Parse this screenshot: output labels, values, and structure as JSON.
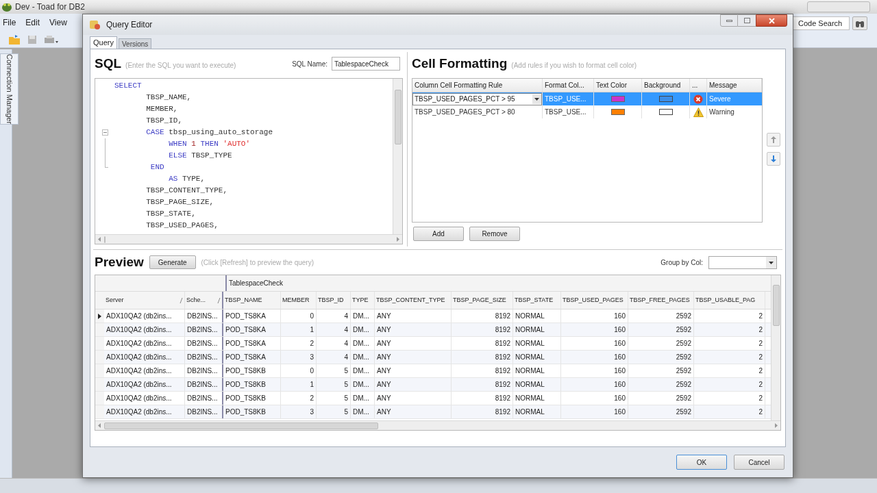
{
  "app": {
    "title": "Dev - Toad for DB2",
    "menu": [
      "File",
      "Edit",
      "View"
    ],
    "side_tab": "Connection Manager",
    "code_search": "Code Search"
  },
  "dialog": {
    "title": "Query Editor",
    "tabs": [
      {
        "label": "Query",
        "selected": true
      },
      {
        "label": "Versions",
        "selected": false
      }
    ],
    "sql": {
      "heading": "SQL",
      "hint": "(Enter the SQL you want to execute)",
      "name_label": "SQL Name:",
      "name_value": "TablespaceCheck",
      "lines": [
        {
          "tokens": [
            {
              "kind": "keyword",
              "text": "SELECT"
            }
          ]
        },
        {
          "tokens": [
            {
              "kind": "ident",
              "text": "       TBSP_NAME,"
            }
          ]
        },
        {
          "tokens": [
            {
              "kind": "ident",
              "text": "       MEMBER,"
            }
          ]
        },
        {
          "tokens": [
            {
              "kind": "ident",
              "text": "       TBSP_ID,"
            }
          ]
        },
        {
          "kind": "fold_start",
          "tokens": [
            {
              "kind": "keyword",
              "text": "       CASE"
            },
            {
              "kind": "ident",
              "text": " tbsp_using_auto_storage"
            }
          ]
        },
        {
          "kind": "fold_inside",
          "tokens": [
            {
              "kind": "keyword",
              "text": "            WHEN"
            },
            {
              "kind": "number",
              "text": " 1"
            },
            {
              "kind": "keyword",
              "text": " THEN"
            },
            {
              "kind": "string",
              "text": " 'AUTO'"
            }
          ]
        },
        {
          "kind": "fold_inside",
          "tokens": [
            {
              "kind": "keyword",
              "text": "            ELSE"
            },
            {
              "kind": "ident",
              "text": " TBSP_TYPE"
            }
          ]
        },
        {
          "kind": "fold_end",
          "tokens": [
            {
              "kind": "keyword",
              "text": "        END"
            }
          ]
        },
        {
          "tokens": [
            {
              "kind": "keyword",
              "text": "            AS"
            },
            {
              "kind": "ident",
              "text": " TYPE,"
            }
          ]
        },
        {
          "tokens": [
            {
              "kind": "ident",
              "text": "       TBSP_CONTENT_TYPE,"
            }
          ]
        },
        {
          "tokens": [
            {
              "kind": "ident",
              "text": "       TBSP_PAGE_SIZE,"
            }
          ]
        },
        {
          "tokens": [
            {
              "kind": "ident",
              "text": "       TBSP_STATE,"
            }
          ]
        },
        {
          "tokens": [
            {
              "kind": "ident",
              "text": "       TBSP_USED_PAGES,"
            }
          ]
        }
      ]
    },
    "formatting": {
      "heading": "Cell Formatting",
      "hint": "(Add rules if you wish to format cell color)",
      "columns": [
        "Column Cell Formatting Rule",
        "Format Col...",
        "Text Color",
        "Background",
        "...",
        "Message"
      ],
      "rules": [
        {
          "rule": "TBSP_USED_PAGES_PCT > 95",
          "format_column": "TBSP_USE...",
          "text_color": {
            "color": "#cc33cc"
          },
          "background": {
            "color": "#3c8ee8"
          },
          "kind": "error",
          "message": "Severe",
          "selected": true
        },
        {
          "rule": "TBSP_USED_PAGES_PCT > 80",
          "format_column": "TBSP_USE...",
          "text_color": {
            "color": "#ff8000"
          },
          "background": {
            "color": "#ffffff"
          },
          "kind": "warning",
          "message": "Warning",
          "selected": false
        }
      ],
      "buttons": [
        "Add",
        "Remove"
      ]
    },
    "preview": {
      "heading": "Preview",
      "generate": "Generate",
      "hint": "(Click [Refresh] to preview the query)",
      "group_label": "Group by Col:",
      "band": "TablespaceCheck",
      "columns": [
        "Server",
        "Sche...",
        "TBSP_NAME",
        "MEMBER",
        "TBSP_ID",
        "TYPE",
        "TBSP_CONTENT_TYPE",
        "TBSP_PAGE_SIZE",
        "TBSP_STATE",
        "TBSP_USED_PAGES",
        "TBSP_FREE_PAGES",
        "TBSP_USABLE_PAG"
      ],
      "rows": [
        {
          "current": true,
          "cells": [
            "ADX10QA2 (db2ins...",
            "DB2INS...",
            "POD_TS8KA",
            "0",
            "4",
            "DM...",
            "ANY",
            "8192",
            "NORMAL",
            "160",
            "2592",
            "2"
          ]
        },
        {
          "current": false,
          "cells": [
            "ADX10QA2 (db2ins...",
            "DB2INS...",
            "POD_TS8KA",
            "1",
            "4",
            "DM...",
            "ANY",
            "8192",
            "NORMAL",
            "160",
            "2592",
            "2"
          ]
        },
        {
          "current": false,
          "cells": [
            "ADX10QA2 (db2ins...",
            "DB2INS...",
            "POD_TS8KA",
            "2",
            "4",
            "DM...",
            "ANY",
            "8192",
            "NORMAL",
            "160",
            "2592",
            "2"
          ]
        },
        {
          "current": false,
          "cells": [
            "ADX10QA2 (db2ins...",
            "DB2INS...",
            "POD_TS8KA",
            "3",
            "4",
            "DM...",
            "ANY",
            "8192",
            "NORMAL",
            "160",
            "2592",
            "2"
          ]
        },
        {
          "current": false,
          "cells": [
            "ADX10QA2 (db2ins...",
            "DB2INS...",
            "POD_TS8KB",
            "0",
            "5",
            "DM...",
            "ANY",
            "8192",
            "NORMAL",
            "160",
            "2592",
            "2"
          ]
        },
        {
          "current": false,
          "cells": [
            "ADX10QA2 (db2ins...",
            "DB2INS...",
            "POD_TS8KB",
            "1",
            "5",
            "DM...",
            "ANY",
            "8192",
            "NORMAL",
            "160",
            "2592",
            "2"
          ]
        },
        {
          "current": false,
          "cells": [
            "ADX10QA2 (db2ins...",
            "DB2INS...",
            "POD_TS8KB",
            "2",
            "5",
            "DM...",
            "ANY",
            "8192",
            "NORMAL",
            "160",
            "2592",
            "2"
          ]
        },
        {
          "current": false,
          "cells": [
            "ADX10QA2 (db2ins...",
            "DB2INS...",
            "POD_TS8KB",
            "3",
            "5",
            "DM...",
            "ANY",
            "8192",
            "NORMAL",
            "160",
            "2592",
            "2"
          ]
        }
      ]
    },
    "buttons": [
      "OK",
      "Cancel"
    ]
  }
}
